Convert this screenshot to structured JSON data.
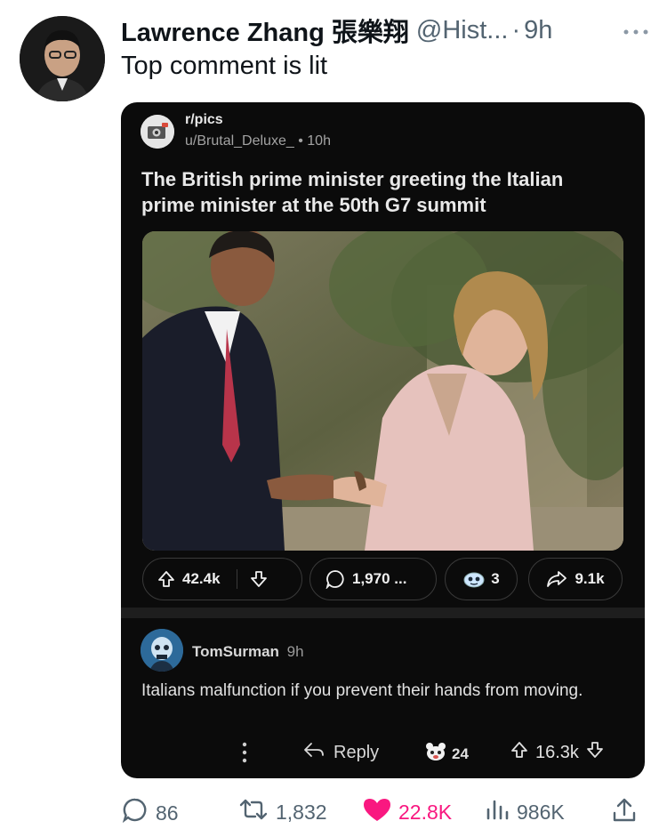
{
  "tweet": {
    "author_name": "Lawrence Zhang 張樂翔",
    "author_handle": "@Hist...",
    "separator": "·",
    "time": "9h",
    "text": "Top comment is lit",
    "more_icon": "more-horizontal-icon"
  },
  "reddit_card": {
    "subreddit": "r/pics",
    "poster": "u/Brutal_Deluxe_",
    "meta_separator": "•",
    "post_time": "10h",
    "title": "The British prime minister greeting the Italian prime minister at the 50th G7 summit",
    "upvotes": "42.4k",
    "comments": "1,970 ...",
    "awards": "3",
    "shares": "9.1k",
    "comment": {
      "username": "TomSurman",
      "time": "9h",
      "text": "Italians malfunction if you prevent their hands from moving.",
      "reply_label": "Reply",
      "award_count": "24",
      "score": "16.3k"
    }
  },
  "tweet_actions": {
    "replies": "86",
    "retweets": "1,832",
    "likes": "22.8K",
    "views": "986K"
  },
  "colors": {
    "like": "#f91880",
    "secondary_text": "#536471",
    "card_bg": "#0b0b0b"
  }
}
